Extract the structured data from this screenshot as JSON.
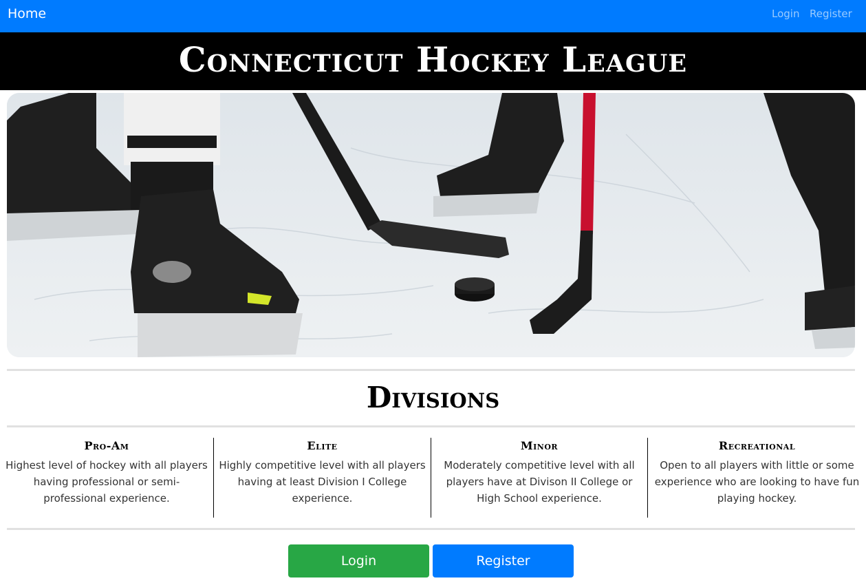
{
  "nav": {
    "home": "Home",
    "login": "Login",
    "register": "Register"
  },
  "site_title": "Connecticut Hockey League",
  "hero": {
    "icon": "hockey-photo"
  },
  "divisions_heading": "Divisions",
  "divisions": [
    {
      "name": "Pro-Am",
      "description": "Highest level of hockey with all players having professional or semi-professional experience."
    },
    {
      "name": "Elite",
      "description": "Highly competitive level with all players having at least Division I College experience."
    },
    {
      "name": "Minor",
      "description": "Moderately competitive level with all players have at Divison II College or High School experience."
    },
    {
      "name": "Recreational",
      "description": "Open to all players with little or some experience who are looking to have fun playing hockey."
    }
  ],
  "buttons": {
    "login": "Login",
    "register": "Register"
  },
  "colors": {
    "navbar": "#007bff",
    "title_bar": "#000000",
    "login_button": "#28a745",
    "register_button": "#007bff"
  }
}
